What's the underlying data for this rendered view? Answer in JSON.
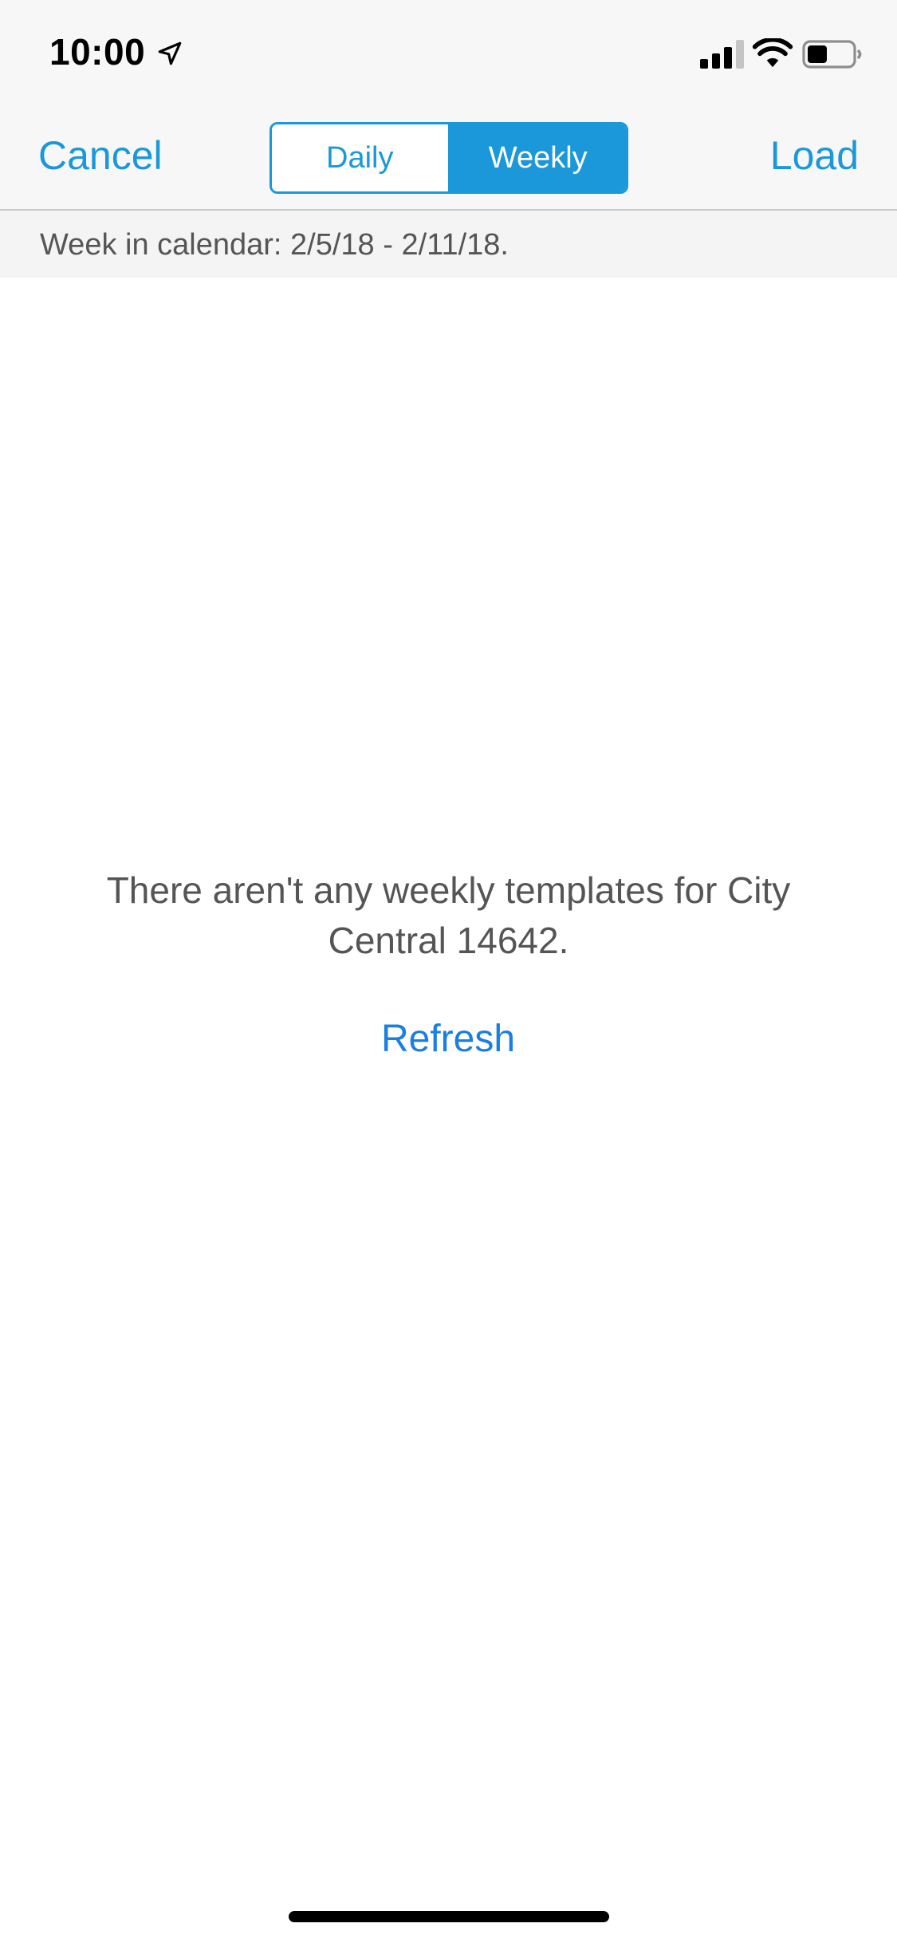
{
  "status_bar": {
    "time": "10:00",
    "icons": [
      "location-arrow-icon",
      "cellular-signal-icon",
      "wifi-icon",
      "battery-icon"
    ]
  },
  "nav_bar": {
    "cancel_label": "Cancel",
    "load_label": "Load",
    "segments": [
      {
        "label": "Daily",
        "selected": false
      },
      {
        "label": "Weekly",
        "selected": true
      }
    ]
  },
  "sub_header": {
    "text": "Week in calendar: 2/5/18 - 2/11/18."
  },
  "content": {
    "empty_message": "There aren't any weekly templates for City Central 14642.",
    "refresh_label": "Refresh"
  },
  "colors": {
    "accent": "#1a98d9",
    "link": "#1a7fe0",
    "bar_background": "#f7f7f7",
    "text_secondary": "#555555"
  }
}
